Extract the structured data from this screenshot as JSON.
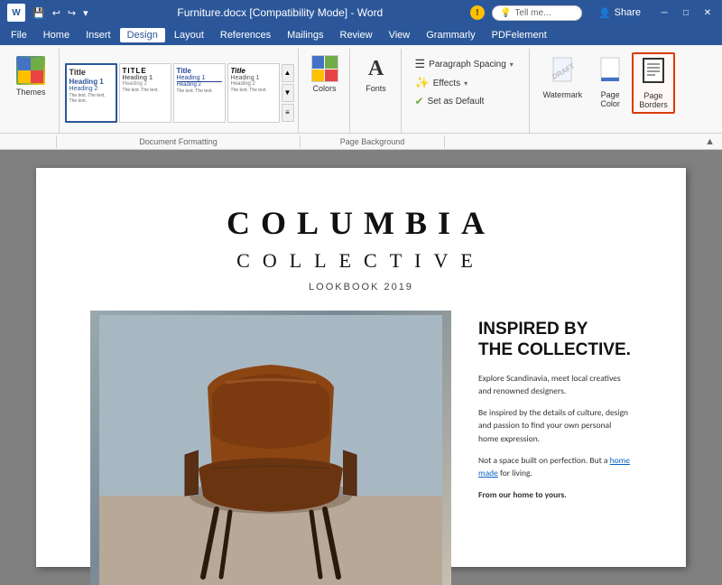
{
  "titleBar": {
    "logo": "W",
    "filename": "Furniture.docx [Compatibility Mode] - Word",
    "buttons": {
      "minimize": "─",
      "maximize": "□",
      "close": "✕"
    },
    "quickAccess": [
      "💾",
      "↩",
      "↪"
    ],
    "warn": "!",
    "tellMe": "Tell me...",
    "share": "Share"
  },
  "menuBar": {
    "items": [
      "File",
      "Home",
      "Insert",
      "Design",
      "Layout",
      "References",
      "Mailings",
      "Review",
      "View",
      "Grammarly",
      "PDFelement"
    ]
  },
  "ribbon": {
    "themes_label": "Themes",
    "docFormatting_label": "Document Formatting",
    "pageBackground_label": "Page Background",
    "thumbs": [
      {
        "title": "Title",
        "h1": "Heading 1",
        "h2": "Heading 2",
        "selected": true
      },
      {
        "title": "TITLE",
        "h1": "Heading 1",
        "h2": "Heading 2"
      },
      {
        "title": "Title",
        "h1": "Heading 1",
        "h2": "Heading 2"
      },
      {
        "title": "Title",
        "h1": "Heading 1",
        "h2": "Heading 2"
      }
    ],
    "colors_label": "Colors",
    "fonts_label": "Fonts",
    "paraSpacing_label": "Paragraph Spacing",
    "effects_label": "Effects",
    "setDefault_label": "Set as Default",
    "watermark_label": "Watermark",
    "pageColor_label": "Page\nColor",
    "pageBorders_label": "Page\nBorders"
  },
  "document": {
    "title1": "COLUMBIA",
    "title2": "COLLECTIVE",
    "lookbook": "LOOKBOOK 2019",
    "inspiredTitle": "INSPIRED BY\nTHE COLLECTIVE.",
    "para1": "Explore Scandinavia, meet local creatives\nand renowned designers.",
    "para2": "Be inspired by the details of culture,\ndesign and passion to find your own\npersonal home expression.",
    "para3": "Not a space built on perfection. But a",
    "linkText": "home made",
    "para3rest": " for living.",
    "para4": "From our home to yours."
  }
}
